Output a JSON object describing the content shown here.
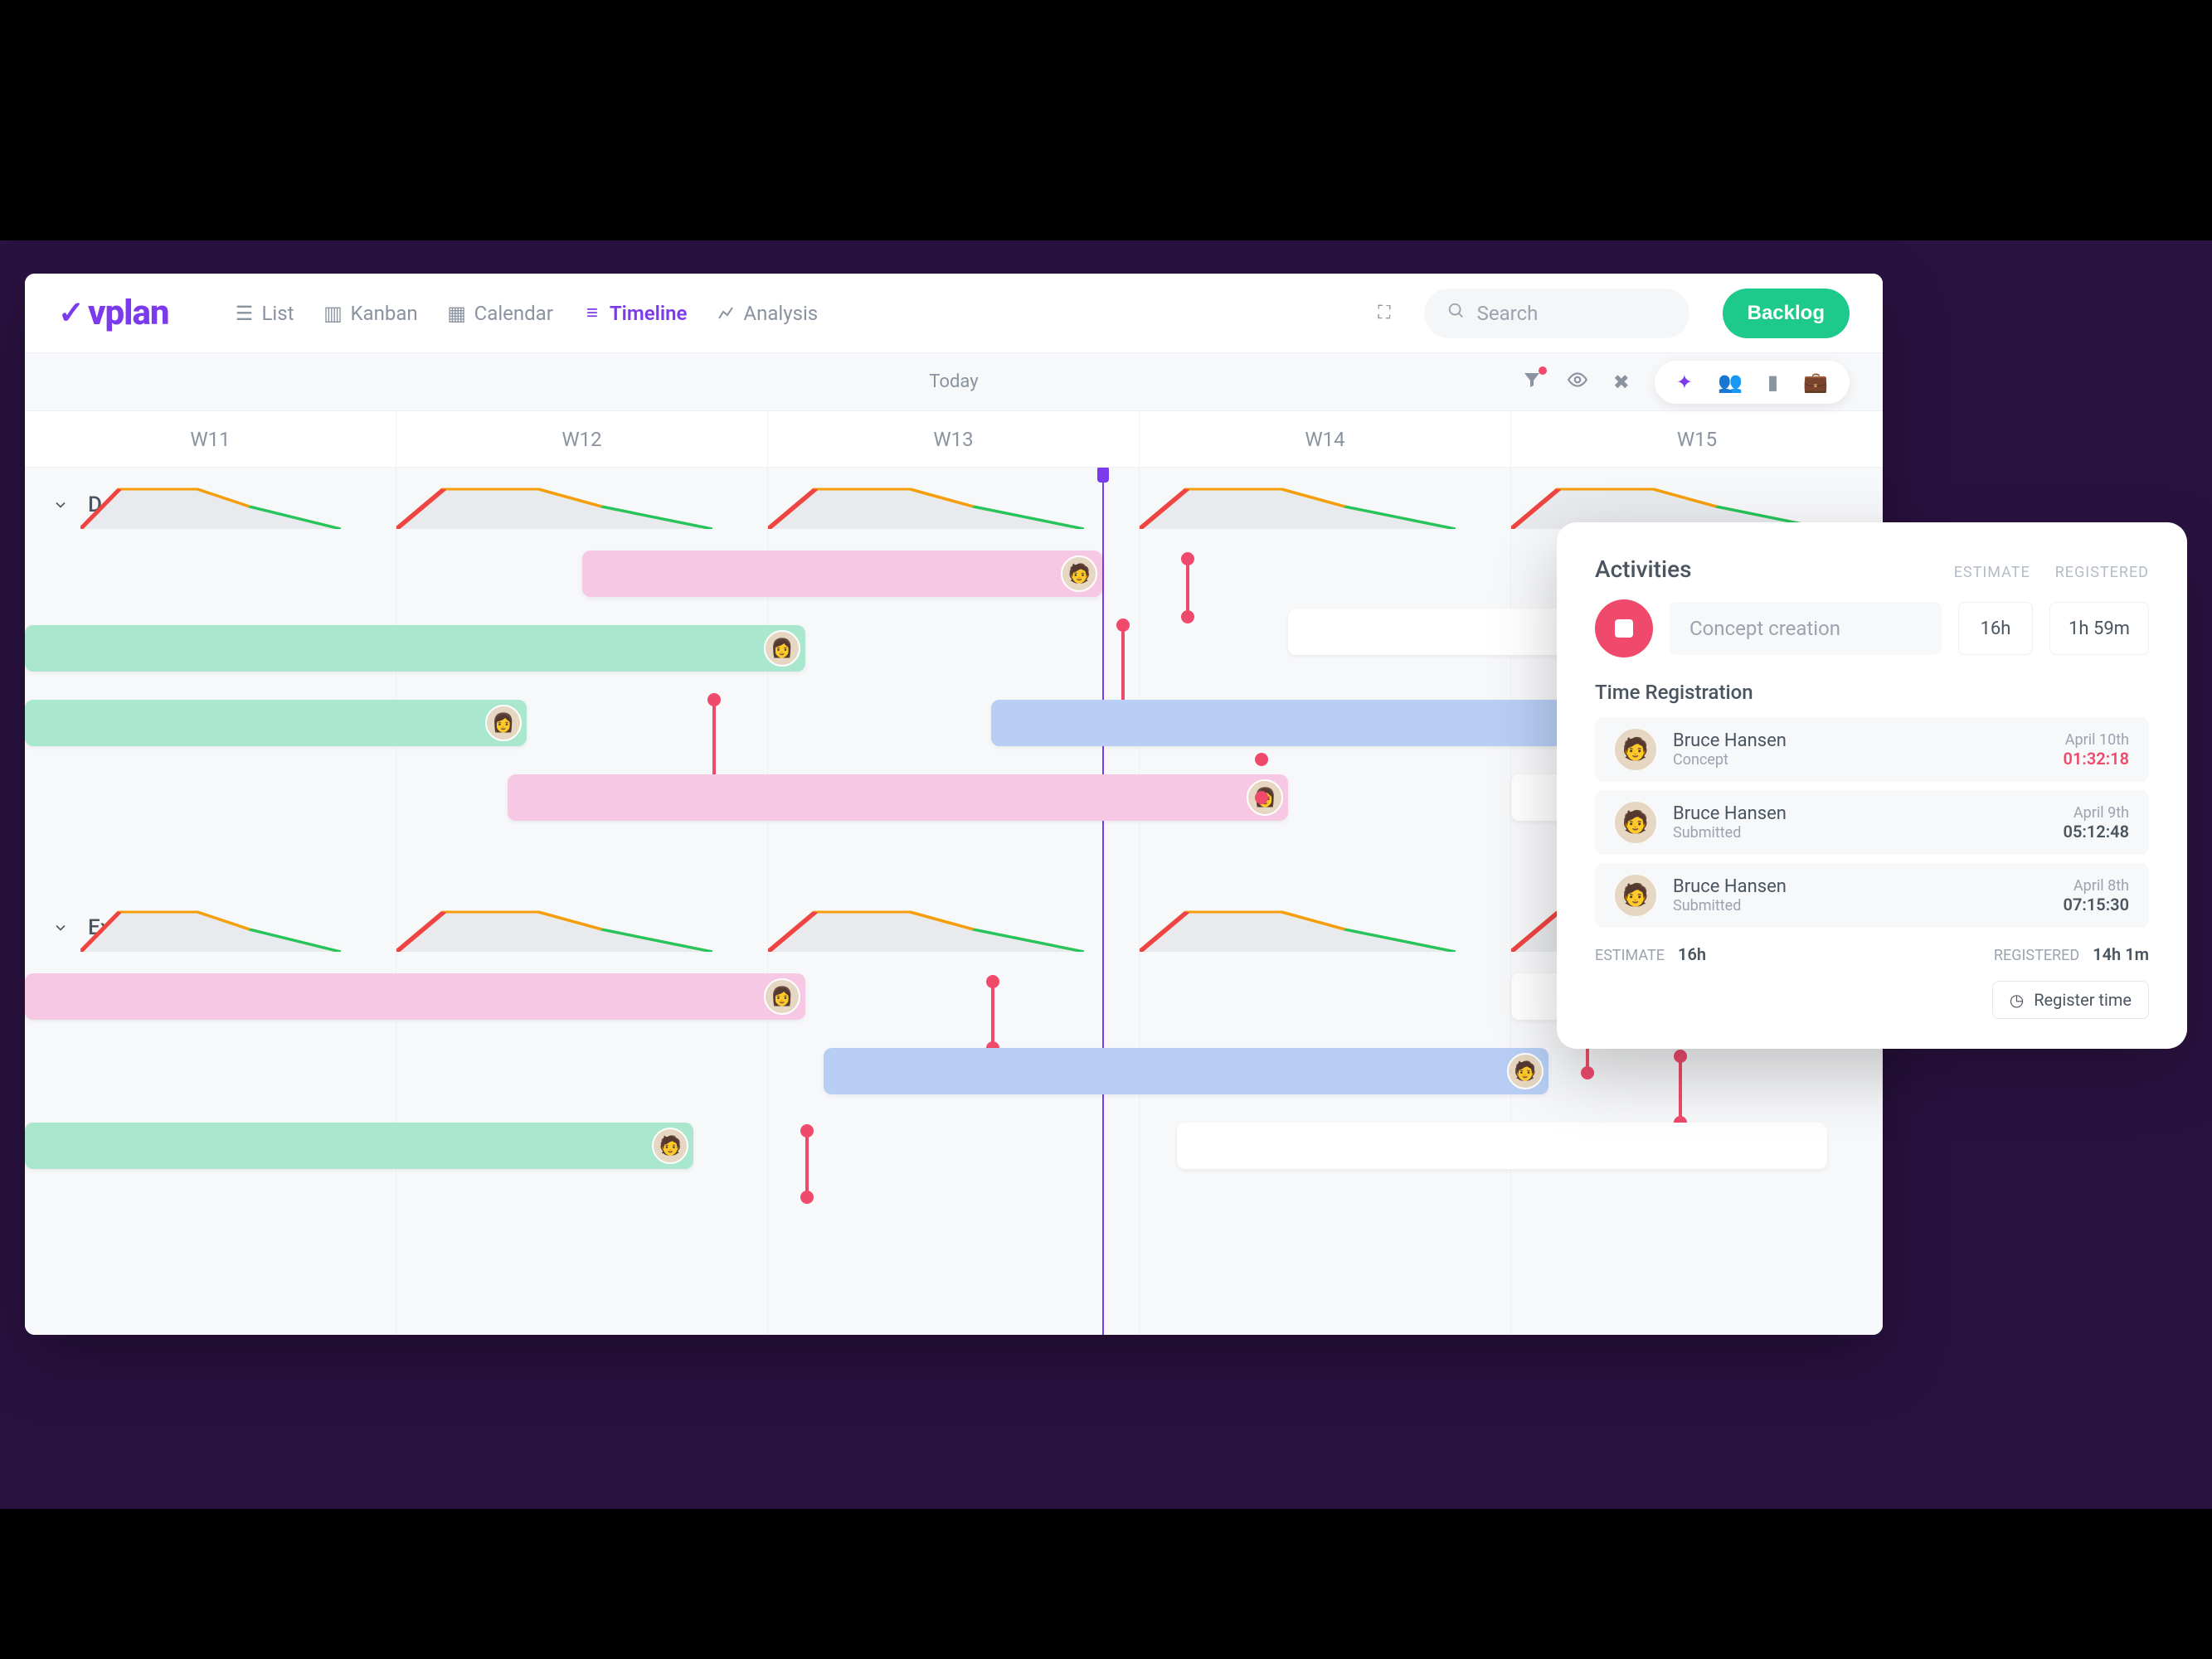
{
  "brand": "vplan",
  "nav": {
    "list": "List",
    "kanban": "Kanban",
    "calendar": "Calendar",
    "timeline": "Timeline",
    "analysis": "Analysis"
  },
  "search": {
    "placeholder": "Search"
  },
  "backlog": "Backlog",
  "today": "Today",
  "weeks": [
    "W11",
    "W12",
    "W13",
    "W14",
    "W15"
  ],
  "groups": {
    "design": "Design",
    "execution": "Execution"
  },
  "panel": {
    "title": "Activities",
    "col_estimate": "ESTIMATE",
    "col_registered": "REGISTERED",
    "activity_name": "Concept creation",
    "estimate": "16h",
    "registered": "1h 59m",
    "section": "Time Registration",
    "entries": [
      {
        "name": "Bruce Hansen",
        "status": "Concept",
        "date": "April 10th",
        "time": "01:32:18",
        "live": true
      },
      {
        "name": "Bruce Hansen",
        "status": "Submitted",
        "date": "April 9th",
        "time": "05:12:48",
        "live": false
      },
      {
        "name": "Bruce Hansen",
        "status": "Submitted",
        "date": "April 8th",
        "time": "07:15:30",
        "live": false
      }
    ],
    "tot_estimate_label": "ESTIMATE",
    "tot_estimate_value": "16h",
    "tot_registered_label": "REGISTERED",
    "tot_registered_value": "14h 1m",
    "register_btn": "Register time"
  }
}
